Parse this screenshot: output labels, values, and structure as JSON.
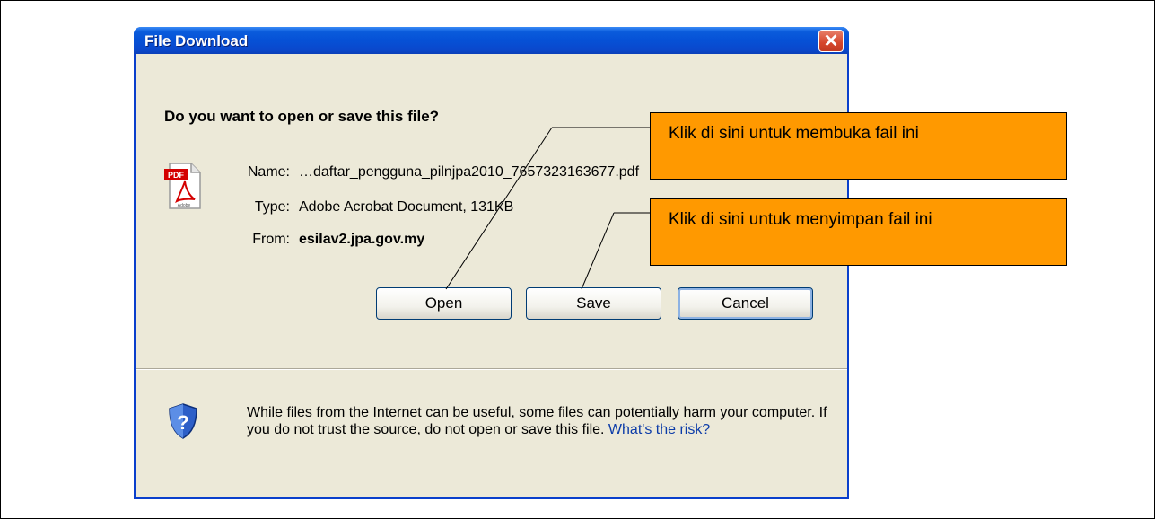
{
  "dialog": {
    "title": "File Download",
    "close_symbol": "✕",
    "question": "Do you want to open or save this file?",
    "file_icon": "pdf-file-icon",
    "name_label": "Name:",
    "name_value": "…daftar_pengguna_pilnjpa2010_7657323163677.pdf",
    "type_label": "Type:",
    "type_value": "Adobe Acrobat Document, 131KB",
    "from_label": "From:",
    "from_value": "esilav2.jpa.gov.my",
    "buttons": {
      "open": "Open",
      "save": "Save",
      "cancel": "Cancel"
    },
    "warning_icon": "shield-question-icon",
    "warning_text": "While files from the Internet can be useful, some files can potentially harm your computer. If you do not trust the source, do not open or save this file.",
    "risk_link": "What's the risk?"
  },
  "callouts": {
    "open": "Klik di sini untuk membuka fail ini",
    "save": "Klik di sini untuk menyimpan fail ini"
  },
  "colors": {
    "titlebar": "#0651d6",
    "dialog_bg": "#ece9d8",
    "callout_bg": "#ff9900",
    "link": "#0b3ba8"
  }
}
